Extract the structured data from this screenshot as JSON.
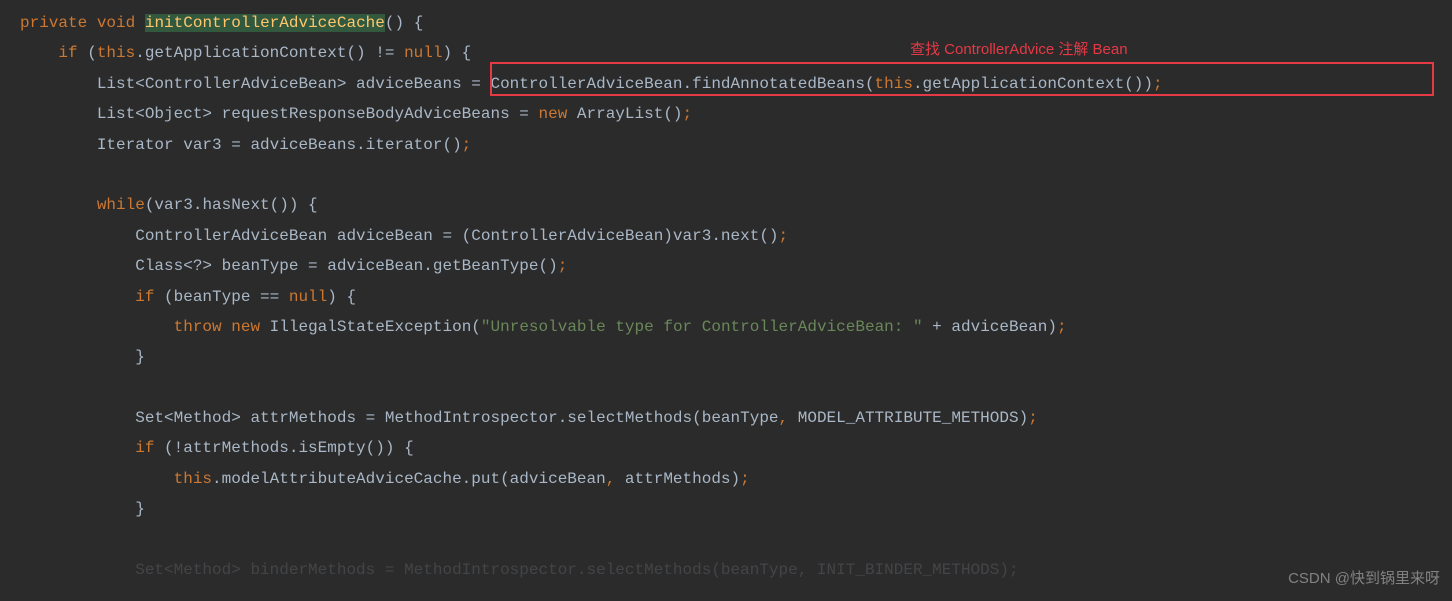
{
  "annotation": {
    "label": "查找 ControllerAdvice 注解 Bean"
  },
  "watermark": "CSDN @快到锅里来呀",
  "code": {
    "l1_private": "private",
    "l1_void": "void",
    "l1_method": "initControllerAdviceCache",
    "l1_rest": "() {",
    "l2_if": "if",
    "l2_open": " (",
    "l2_this": "this",
    "l2_mid": ".getApplicationContext() != ",
    "l2_null": "null",
    "l2_end": ") {",
    "l3_a": "List<ControllerAdviceBean> adviceBeans = ControllerAdviceBean.findAnnotatedBeans(",
    "l3_this": "this",
    "l3_b": ".getApplicationContext())",
    "l3_semi": ";",
    "l4_a": "List<Object> requestResponseBodyAdviceBeans = ",
    "l4_new": "new",
    "l4_b": " ArrayList()",
    "l4_semi": ";",
    "l5_a": "Iterator var3 = adviceBeans.iterator()",
    "l5_semi": ";",
    "l7_while": "while",
    "l7_rest": "(var3.hasNext()) {",
    "l8_a": "ControllerAdviceBean adviceBean = (ControllerAdviceBean)var3.next()",
    "l8_semi": ";",
    "l9_a": "Class<?> beanType = adviceBean.getBeanType()",
    "l9_semi": ";",
    "l10_if": "if",
    "l10_a": " (beanType == ",
    "l10_null": "null",
    "l10_b": ") {",
    "l11_throw": "throw",
    "l11_new": "new",
    "l11_a": " IllegalStateException(",
    "l11_str": "\"Unresolvable type for ControllerAdviceBean: \"",
    "l11_b": " + adviceBean)",
    "l11_semi": ";",
    "l12": "}",
    "l14_a": "Set<Method> attrMethods = MethodIntrospector.selectMethods(beanType",
    "l14_comma": ",",
    "l14_b": " MODEL_ATTRIBUTE_METHODS)",
    "l14_semi": ";",
    "l15_if": "if",
    "l15_rest": " (!attrMethods.isEmpty()) {",
    "l16_this": "this",
    "l16_a": ".modelAttributeAdviceCache.put(adviceBean",
    "l16_comma": ",",
    "l16_b": " attrMethods)",
    "l16_semi": ";",
    "l17": "}",
    "l19": "Set<Method> binderMethods = MethodIntrospector.selectMethods(beanType, INIT_BINDER_METHODS);"
  }
}
